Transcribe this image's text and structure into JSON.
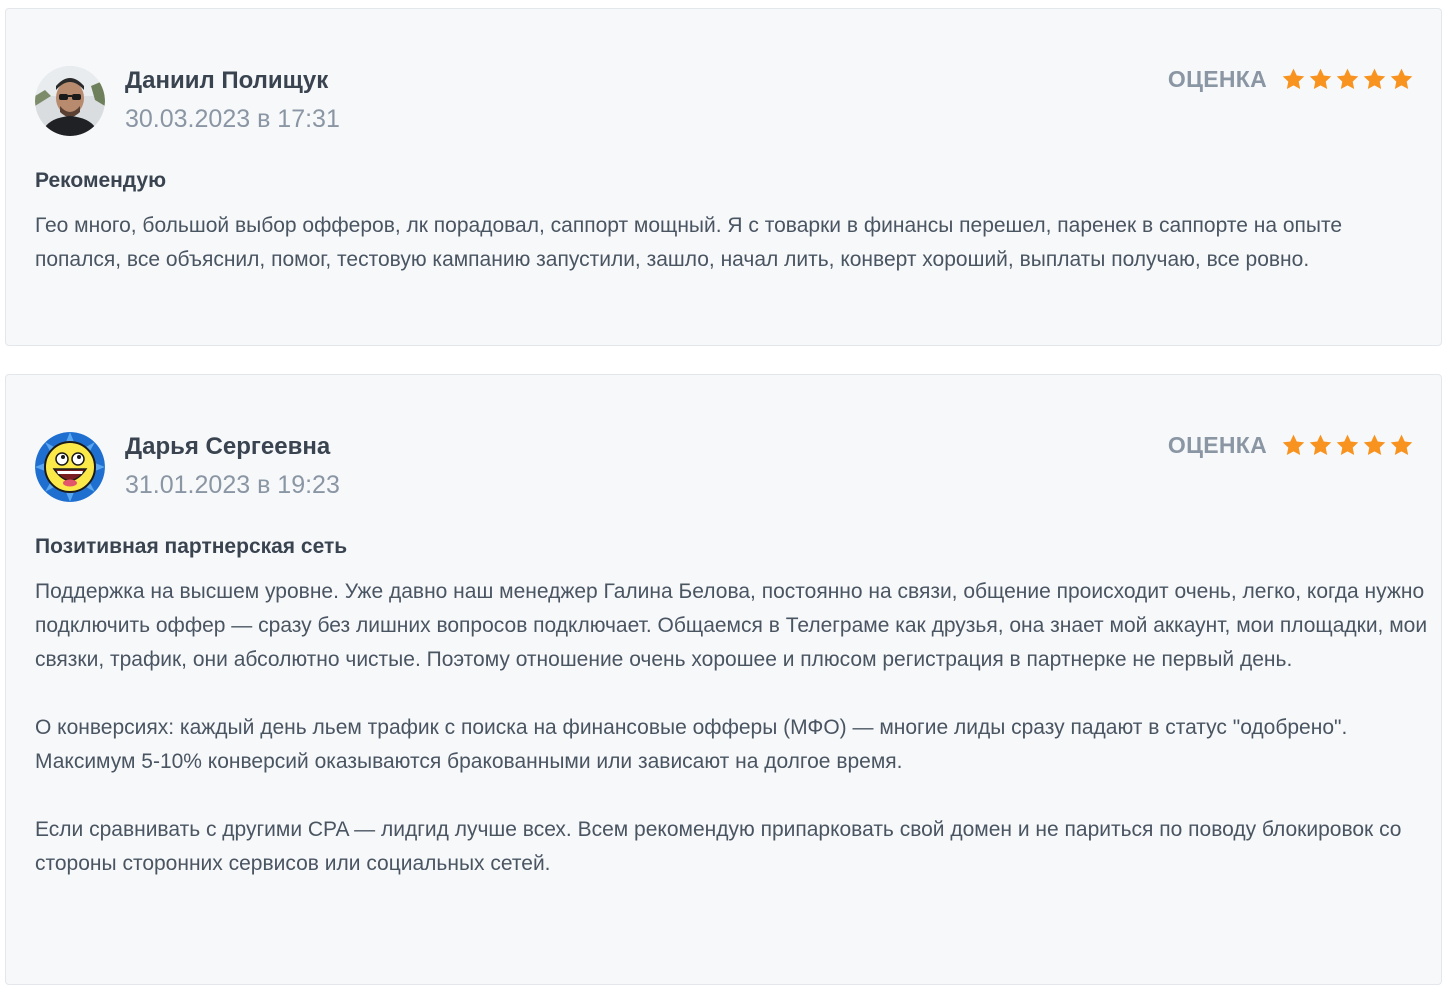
{
  "reviews": [
    {
      "author": "Даниил Полищук",
      "date": "30.03.2023 в 17:31",
      "rating_label": "ОЦЕНКА",
      "rating": 5,
      "rating_max": 5,
      "title": "Рекомендую",
      "paragraphs": [
        "Гео много, большой выбор офферов, лк порадовал, саппорт мощный. Я с товарки в финансы перешел, паренек в саппорте на опыте попался, все объяснил, помог, тестовую кампанию запустили, зашло, начал лить, конверт хороший, выплаты получаю, все ровно."
      ]
    },
    {
      "author": "Дарья Сергеевна",
      "date": "31.01.2023 в 19:23",
      "rating_label": "ОЦЕНКА",
      "rating": 5,
      "rating_max": 5,
      "title": "Позитивная партнерская сеть",
      "paragraphs": [
        "Поддержка на высшем уровне. Уже давно наш менеджер Галина Белова, постоянно на связи, общение происходит очень, легко, когда нужно подключить оффер — сразу без лишних вопросов подключает. Общаемся в Телеграме как друзья, она знает мой аккаунт, мои площадки, мои связки, трафик, они абсолютно чистые. Поэтому отношение очень хорошее и плюсом регистрация в партнерке не первый день.",
        "О конверсиях: каждый день льем трафик с поиска на финансовые офферы (МФО) — многие лиды сразу падают в статус \"одобрено\". Максимум 5-10% конверсий оказываются бракованными или зависают на долгое время.",
        "Если сравнивать с другими CPA — лидгид лучше всех. Всем рекомендую припарковать свой домен и не париться по поводу блокировок со стороны сторонних сервисов или социальных сетей."
      ]
    }
  ],
  "colors": {
    "card_background": "#f7f8fa",
    "card_border": "#e3e6ea",
    "star": "#f7931e",
    "muted_text": "#8a96a3",
    "heading_text": "#3a4450"
  },
  "icons": {
    "avatar_1": "avatar-photo-man-sunglasses",
    "avatar_2": "avatar-awesome-face",
    "star": "star-icon"
  }
}
